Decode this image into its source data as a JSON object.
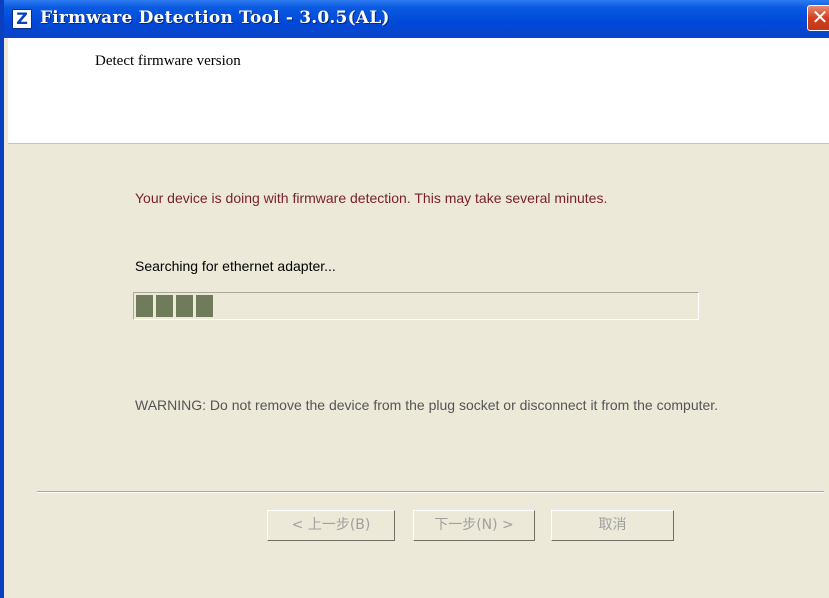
{
  "window": {
    "title": "Firmware Detection Tool - 3.0.5(AL)",
    "app_icon_glyph": "Z",
    "close_glyph": "✕"
  },
  "header": {
    "title": "Detect firmware version"
  },
  "main": {
    "message": "Your device is doing with firmware detection. This may take several minutes.",
    "status": "Searching for ethernet adapter...",
    "progress": {
      "filled_blocks": 4,
      "fraction": 0.15
    },
    "warning": "WARNING: Do not remove the device from the plug socket or disconnect it from the computer."
  },
  "buttons": {
    "back_label": "< 上一步(B)",
    "next_label": "下一步(N) >",
    "cancel_label": "取消"
  },
  "colors": {
    "titlebar": "#0048d8",
    "message_text": "#7a1e2a",
    "progress_fill": "#6f7b5b",
    "dialog_bg": "#ece9d8"
  },
  "icons": [
    "app-logo-icon",
    "close-icon"
  ]
}
